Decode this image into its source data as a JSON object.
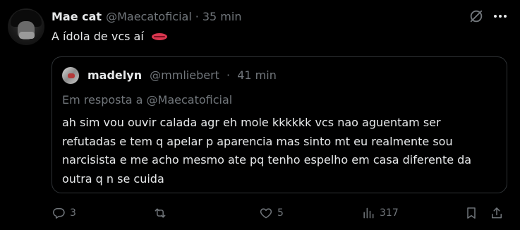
{
  "tweet": {
    "author_name": "Mae cat",
    "author_handle": "@Maecatoficial",
    "separator": "·",
    "time": "35 min",
    "text": "A ídola de vcs aí"
  },
  "quote": {
    "author_name": "madelyn",
    "author_handle": "@mmliebert",
    "separator": "·",
    "time": "41 min",
    "reply_to": "Em resposta a @Maecatoficial",
    "text": "ah sim vou ouvir calada agr eh mole kkkkkk vcs nao aguentam ser refutadas e tem q apelar p aparencia mas sinto mt eu realmente sou narcisista e me acho mesmo ate pq tenho espelho em casa diferente da outra q n se cuida"
  },
  "actions": {
    "replies": "3",
    "retweets": "",
    "likes": "5",
    "views": "317"
  },
  "icons": {
    "reply": "reply-icon",
    "retweet": "retweet-icon",
    "like": "heart-icon",
    "views": "views-icon",
    "bookmark": "bookmark-icon",
    "share": "share-icon",
    "grok": "grok-icon",
    "more": "more-icon",
    "emoji": "lips-emoji"
  },
  "colors": {
    "background": "#000000",
    "text": "#e7e9ea",
    "muted": "#71767b",
    "border": "#2f3336"
  }
}
